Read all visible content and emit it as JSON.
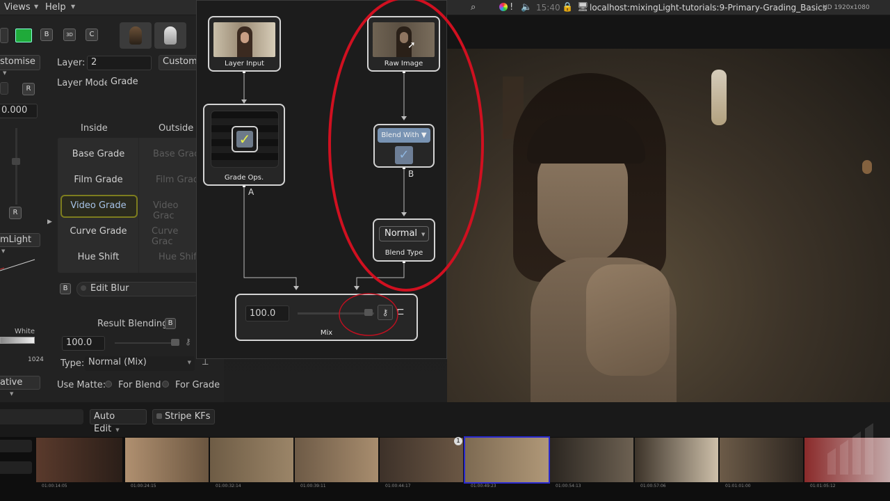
{
  "menu": {
    "views": "Views",
    "help": "Help"
  },
  "status": {
    "clock": "15:40",
    "url": "localhost:mixingLight-tutorials:9-Primary-Grading_Basics",
    "resolution": "HD 1920x1080"
  },
  "left": {
    "customise_left": "stomise",
    "layer_label": "Layer:",
    "layer_value": "2",
    "customise_btn": "Customis",
    "layer_mode_label": "Layer Mode",
    "layer_mode_value": "Grade",
    "value_field": "0.000",
    "btn_r1": "R",
    "btn_r2": "R",
    "inside": "Inside",
    "outside": "Outside",
    "grades_inside": [
      "Base Grade",
      "Film Grade",
      "Video Grade",
      "Curve Grade",
      "Hue Shift"
    ],
    "grades_outside": [
      "Base Grac",
      "Film Grad",
      "Video Grac",
      "Curve Grac",
      "Hue Shift"
    ],
    "mlight": "mLight",
    "edit_blur_btn": "B",
    "edit_blur": "Edit Blur",
    "white": "White",
    "v1024": "1024",
    "result_blending": "Result Blending",
    "result_btn": "B",
    "result_value": "100.0",
    "type_label": "Type:",
    "type_value": "Normal (Mix)",
    "ative": "ative",
    "use_matte": "Use Matte:",
    "for_blend": "For Blend",
    "for_grade": "For Grade",
    "auto_edit": "Auto Edit",
    "stripe_kfs": "Stripe KFs"
  },
  "toolbar": {
    "b": "B",
    "three_d": "3D",
    "c": "C"
  },
  "nodes": {
    "layer_input": "Layer Input",
    "raw_image": "Raw Image",
    "grade_ops": "Grade Ops.",
    "blend_with": "Blend With",
    "blend_type_value": "Normal",
    "blend_type": "Blend Type",
    "mix_value": "100.0",
    "mix": "Mix",
    "a": "A",
    "b": "B"
  },
  "filmstrip": {
    "timecodes": [
      "01:00:14:05",
      "01:00:24:15",
      "01:00:32:14",
      "01:00:39:11",
      "01:00:44:17",
      "01:00:49:23",
      "01:00:54:13",
      "01:00:57:06",
      "01:01:01:00",
      "01:01:05:12"
    ],
    "badge": "1"
  },
  "colors": {
    "accent_red": "#d01020",
    "selected_clip": "#2a2ad0",
    "green_button": "#1faa3a"
  }
}
